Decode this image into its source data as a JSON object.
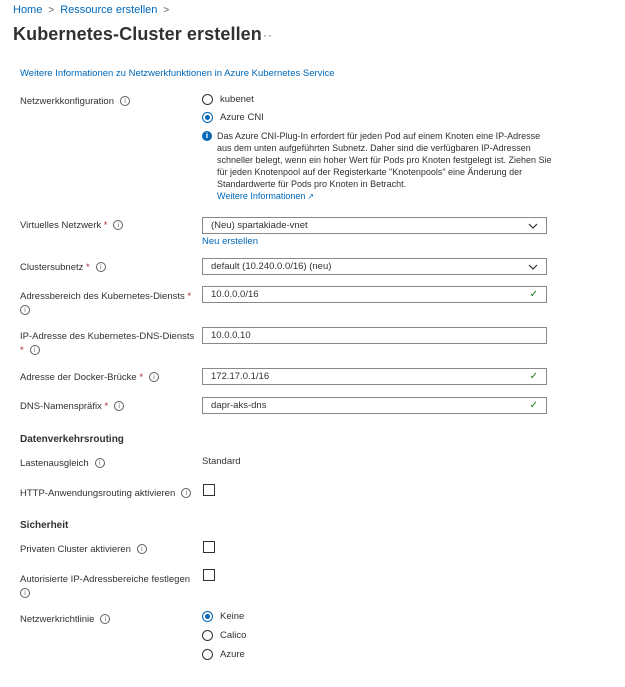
{
  "breadcrumb": {
    "home": "Home",
    "current": "Ressource erstellen",
    "sep": ">"
  },
  "page": {
    "title": "Kubernetes-Cluster erstellen",
    "more": "···"
  },
  "learn_more_link": "Weitere Informationen zu Netzwerkfunktionen in Azure Kubernetes Service",
  "network_config": {
    "label": "Netzwerkkonfiguration",
    "options": [
      "kubenet",
      "Azure CNI"
    ],
    "selected": "Azure CNI",
    "info_text": "Das Azure CNI-Plug-In erfordert für jeden Pod auf einem Knoten eine IP-Adresse aus dem unten aufgeführten Subnetz. Daher sind die verfügbaren IP-Adressen schneller belegt, wenn ein hoher Wert für Pods pro Knoten festgelegt ist. Ziehen Sie für jeden Knotenpool auf der Registerkarte \"Knotenpools\" eine Änderung der Standardwerte für Pods pro Knoten in Betracht.",
    "info_link": "Weitere Informationen"
  },
  "vnet": {
    "label": "Virtuelles Netzwerk",
    "value": "(Neu) spartakiade-vnet",
    "create_new": "Neu erstellen"
  },
  "subnet": {
    "label": "Clustersubnetz",
    "value": "default (10.240.0.0/16) (neu)"
  },
  "service_cidr": {
    "label": "Adressbereich des Kubernetes-Diensts",
    "value": "10.0.0.0/16"
  },
  "dns_ip": {
    "label": "IP-Adresse des Kubernetes-DNS-Diensts",
    "value": "10.0.0.10"
  },
  "docker_bridge": {
    "label": "Adresse der Docker-Brücke",
    "value": "172.17.0.1/16"
  },
  "dns_prefix": {
    "label": "DNS-Namenspräfix",
    "value": "dapr-aks-dns"
  },
  "traffic_routing": {
    "heading": "Datenverkehrsrouting",
    "lb_label": "Lastenausgleich",
    "lb_value": "Standard",
    "http_routing_label": "HTTP-Anwendungsrouting aktivieren"
  },
  "security": {
    "heading": "Sicherheit",
    "private_cluster_label": "Privaten Cluster aktivieren",
    "authorized_ip_label": "Autorisierte IP-Adressbereiche festlegen",
    "network_policy_label": "Netzwerkrichtlinie",
    "network_policy_options": [
      "Keine",
      "Calico",
      "Azure"
    ],
    "network_policy_selected": "Keine"
  },
  "colors": {
    "link": "#0067b8",
    "required": "#a4262c",
    "valid": "#107c10"
  }
}
